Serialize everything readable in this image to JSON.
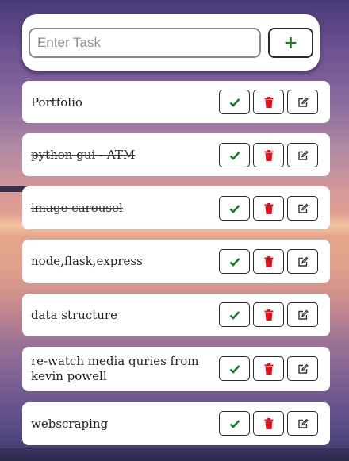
{
  "input": {
    "placeholder": "Enter Task",
    "value": ""
  },
  "add_button": {
    "label": "+"
  },
  "icons": {
    "done": "check-icon",
    "delete": "trash-icon",
    "edit": "edit-icon"
  },
  "colors": {
    "check": "#1a7a2a",
    "delete": "#e0141e",
    "edit": "#333333"
  },
  "tasks": [
    {
      "text": "Portfolio",
      "completed": false
    },
    {
      "text": "python gui - ATM",
      "completed": true
    },
    {
      "text": "image carousel",
      "completed": true
    },
    {
      "text": "node,flask,express",
      "completed": false
    },
    {
      "text": "data structure",
      "completed": false
    },
    {
      "text": "re-watch media quries from kevin powell",
      "completed": false
    },
    {
      "text": "webscraping",
      "completed": false
    }
  ]
}
